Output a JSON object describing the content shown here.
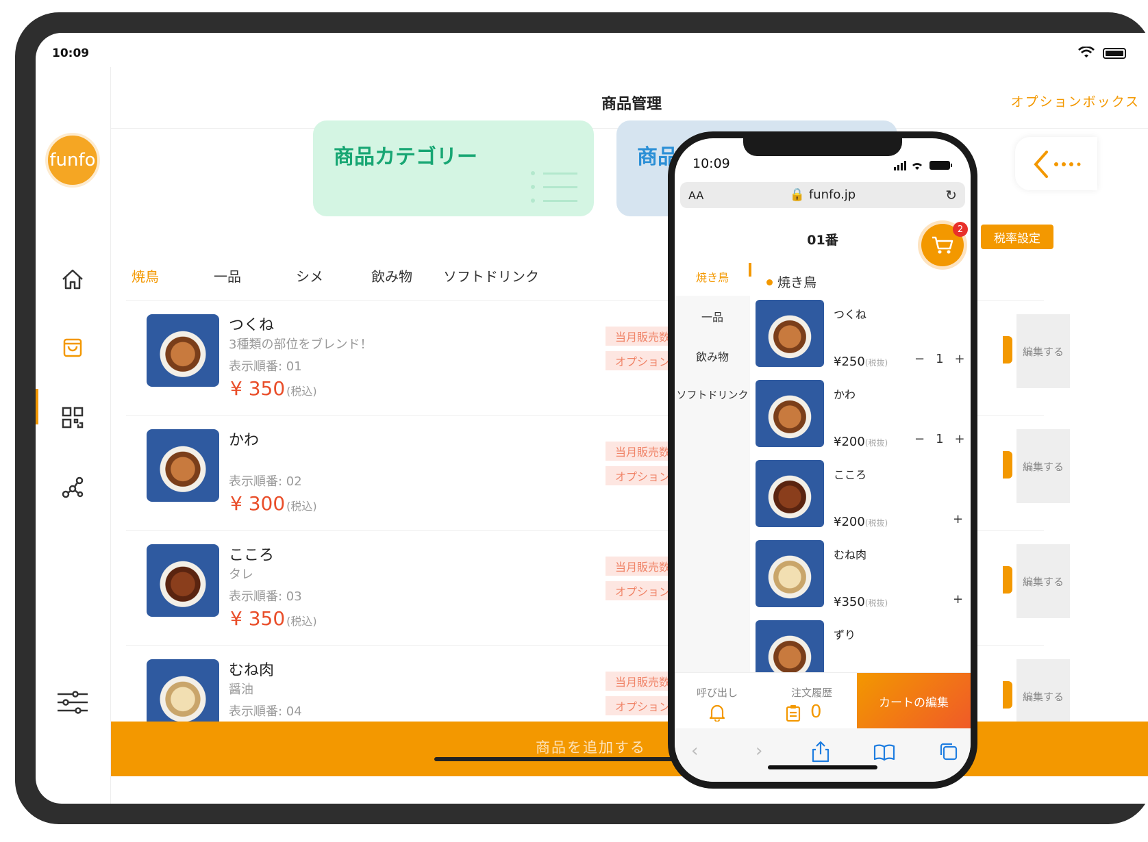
{
  "tablet": {
    "status_time": "10:09",
    "logo_text": "funfo",
    "title": "商品管理",
    "option_box": "オプションボックス",
    "cards": {
      "category": "商品カテゴリー",
      "add": "商品追加"
    },
    "tax_button": "税率設定",
    "tabs": [
      "焼鳥",
      "一品",
      "シメ",
      "飲み物",
      "ソフトドリンク"
    ],
    "products": [
      {
        "name": "つくね",
        "desc": "3種類の部位をブレンド！",
        "order": "表示順番: 01",
        "price": "¥ 350",
        "tax": "(税込)",
        "sold": "当月販売数 0",
        "option": "オプションなし",
        "edit": "編集する"
      },
      {
        "name": "かわ",
        "desc": "",
        "order": "表示順番: 02",
        "price": "¥ 300",
        "tax": "(税込)",
        "sold": "当月販売数 0",
        "option": "オプションなし",
        "edit": "編集する"
      },
      {
        "name": "こころ",
        "desc": "タレ",
        "order": "表示順番: 03",
        "price": "¥ 350",
        "tax": "(税込)",
        "sold": "当月販売数 0",
        "option": "オプションあり",
        "edit": "編集する"
      },
      {
        "name": "むね肉",
        "desc": "醤油",
        "order": "表示順番: 04",
        "price": "",
        "tax": "",
        "sold": "当月販売数 0",
        "option": "オプションあり",
        "edit": "編集する"
      }
    ],
    "add_product": "商品を追加する"
  },
  "phone": {
    "status_time": "10:09",
    "url_aa": "AA",
    "url": "🔒 funfo.jp",
    "table": "01番",
    "cart_count": "2",
    "categories": [
      "焼き鳥",
      "一品",
      "飲み物",
      "ソフトドリンク"
    ],
    "section": "焼き鳥",
    "items": [
      {
        "name": "つくね",
        "price": "¥250",
        "tax": "(税抜)",
        "qty": "1"
      },
      {
        "name": "かわ",
        "price": "¥200",
        "tax": "(税抜)",
        "qty": "1"
      },
      {
        "name": "こころ",
        "price": "¥200",
        "tax": "(税抜)",
        "qty": ""
      },
      {
        "name": "むね肉",
        "price": "¥350",
        "tax": "(税抜)",
        "qty": ""
      },
      {
        "name": "ずり",
        "price": "",
        "tax": "",
        "qty": ""
      }
    ],
    "call": "呼び出し",
    "history": "注文履歴",
    "history_count": "0",
    "cart_edit": "カートの編集"
  },
  "colors": {
    "accent": "#f39800",
    "price": "#e94e2a",
    "card_category": "#d4f5e3",
    "card_add": "#d6e4f0"
  }
}
